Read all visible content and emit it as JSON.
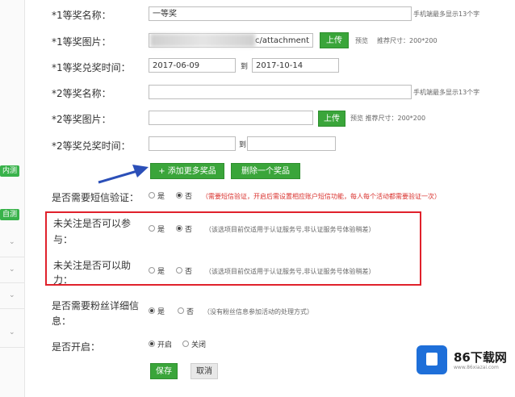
{
  "prize1": {
    "name_label": "*1等奖名称：",
    "name_value": "一等奖",
    "name_hint": "手机端最多显示13个字",
    "image_label": "*1等奖图片：",
    "image_value": "c/attachment",
    "upload": "上传",
    "preview": "预览",
    "size_hint": "推荐尺寸：200*200",
    "time_label": "*1等奖兑奖时间：",
    "start": "2017-06-09",
    "to": "到",
    "end": "2017-10-14"
  },
  "prize2": {
    "name_label": "*2等奖名称：",
    "name_hint": "手机端最多显示13个字",
    "image_label": "*2等奖图片：",
    "upload": "上传",
    "preview_hint": "预览 推荐尺寸：200*200",
    "time_label": "*2等奖兑奖时间：",
    "to": "到"
  },
  "actions": {
    "add_more": "+ 添加更多奖品",
    "delete_one": "删除一个奖品"
  },
  "sms": {
    "label": "是否需要短信验证：",
    "yes": "是",
    "no": "否",
    "hint": "（需要短信验证，开启后需设置相应账户短信功能，每人每个活动都需要验证一次）"
  },
  "follow_join": {
    "label_line1": "未关注是否可以参",
    "label_line2": "与：",
    "yes": "是",
    "no": "否",
    "hint": "（该选项目前仅适用于认证服务号,非认证服务号体验稍差）"
  },
  "follow_help": {
    "label_line1": "未关注是否可以助",
    "label_line2": "力：",
    "yes": "是",
    "no": "否",
    "hint": "（该选项目前仅适用于认证服务号,非认证服务号体验稍差）"
  },
  "fans": {
    "label_line1": "是否需要粉丝详细信",
    "label_line2": "息：",
    "yes": "是",
    "no": "否",
    "hint": "（没有粉丝信息参加活动的处理方式）"
  },
  "enable": {
    "label": "是否开启：",
    "on": "开启",
    "off": "关闭"
  },
  "footer": {
    "save": "保存",
    "cancel": "取消"
  },
  "sidebar": {
    "badge1": "内测",
    "badge2": "自测"
  },
  "watermark": {
    "brand": "86下载网",
    "site": "www.86xiazai.com"
  },
  "colors": {
    "accent_green": "#3aa53a",
    "highlight_red": "#e0212b",
    "arrow_blue": "#2b4fb8"
  }
}
